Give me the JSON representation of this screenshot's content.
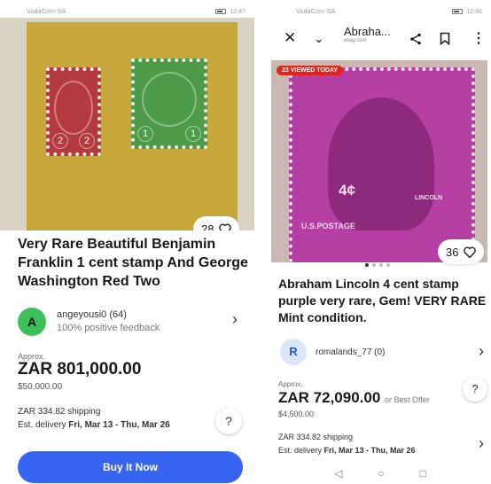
{
  "left": {
    "status": {
      "carrier": "VodaCom-SA",
      "time": "12:47"
    },
    "favorites_count": "28",
    "title": "Very Rare Beautiful Benjamin Franklin 1 cent stamp And George Washington Red Two",
    "seller": {
      "initial": "A",
      "name": "angeyousi0 (64)",
      "feedback": "100% positive feedback",
      "avatar_color": "#3fbf5a"
    },
    "approx_label": "Approx.",
    "price": "ZAR 801,000.00",
    "original_price": "$50,000.00",
    "shipping": "ZAR 334.82 shipping",
    "delivery_prefix": "Est. delivery ",
    "delivery_dates": "Fri, Mar 13 - Thu, Mar 26",
    "help": "?",
    "buy_button": "Buy It Now",
    "accent": "#3665f3"
  },
  "right": {
    "status": {
      "carrier": "VodaCom-SA",
      "time": "12:46"
    },
    "appbar": {
      "title": "Abraha...",
      "domain": "ebay.com"
    },
    "viewed_badge": "23 VIEWED TODAY",
    "stamp_value": "4¢",
    "stamp_postage": "U.S.POSTAGE",
    "stamp_name": "LINCOLN",
    "favorites_count": "36",
    "title": "Abraham Lincoln 4 cent stamp purple very rare, Gem! VERY RARE Mint condition.",
    "seller": {
      "initial": "R",
      "name": "romalands_77 (0)",
      "avatar_color": "#dbe6fb"
    },
    "approx_label": "Approx.",
    "price": "ZAR 72,090.00",
    "or_best_offer": "or Best Offer",
    "original_price": "$4,500.00",
    "shipping": "ZAR 334.82 shipping",
    "delivery_prefix": "Est. delivery ",
    "delivery_dates": "Fri, Mar 13 - Thu, Mar 26",
    "help": "?",
    "badge_color": "#e0241b"
  }
}
